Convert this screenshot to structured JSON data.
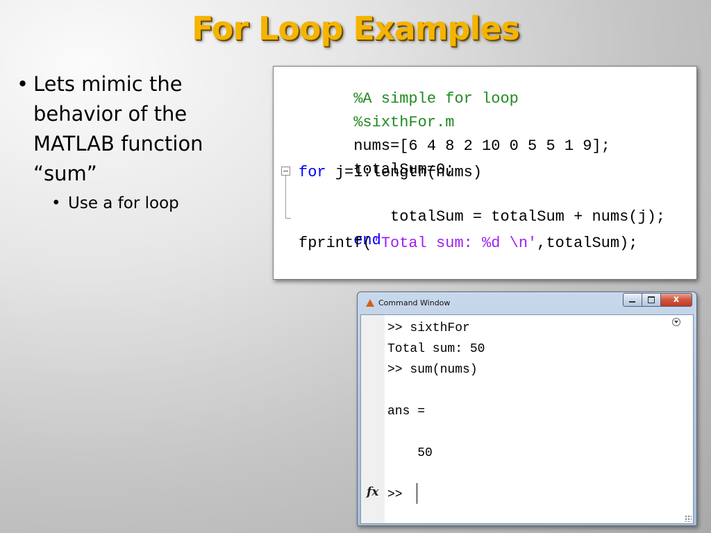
{
  "slide": {
    "title": "For Loop Examples"
  },
  "bullets": {
    "items": [
      {
        "lines": [
          "Lets mimic the",
          "behavior of the",
          "MATLAB function",
          "“sum”"
        ],
        "sub": [
          "Use a for loop"
        ]
      }
    ]
  },
  "editor": {
    "lines": [
      [
        {
          "t": "%A simple for loop",
          "k": "comment"
        }
      ],
      [
        {
          "t": "%sixthFor.m",
          "k": "comment"
        }
      ],
      [
        {
          "t": "nums=[6 4 8 2 10 0 5 5 1 9];",
          "k": "plain"
        }
      ],
      [
        {
          "t": "totalSum=0;",
          "k": "plain"
        }
      ],
      [
        {
          "t": "for",
          "k": "keyword"
        },
        {
          "t": " j=1:length(nums)",
          "k": "plain"
        }
      ],
      [
        {
          "t": "    totalSum = totalSum + nums(j);",
          "k": "plain"
        }
      ],
      [
        {
          "t": "end",
          "k": "keyword"
        }
      ],
      [
        {
          "t": "fprintf(",
          "k": "plain"
        },
        {
          "t": "'Total sum: %d \\n'",
          "k": "string"
        },
        {
          "t": ",totalSum);",
          "k": "plain"
        }
      ]
    ],
    "colors": {
      "comment": "#228b22",
      "keyword": "#0000ff",
      "string": "#a020f0",
      "plain": "#000000"
    }
  },
  "command_window": {
    "title": "Command Window",
    "buttons": {
      "minimize": "minimize-icon",
      "maximize": "maximize-icon",
      "close": "x"
    },
    "lines": [
      ">> sixthFor",
      "Total sum: 50",
      ">> sum(nums)",
      "",
      "ans =",
      "",
      "    50",
      "",
      ">> "
    ],
    "fx_label": "fx"
  }
}
